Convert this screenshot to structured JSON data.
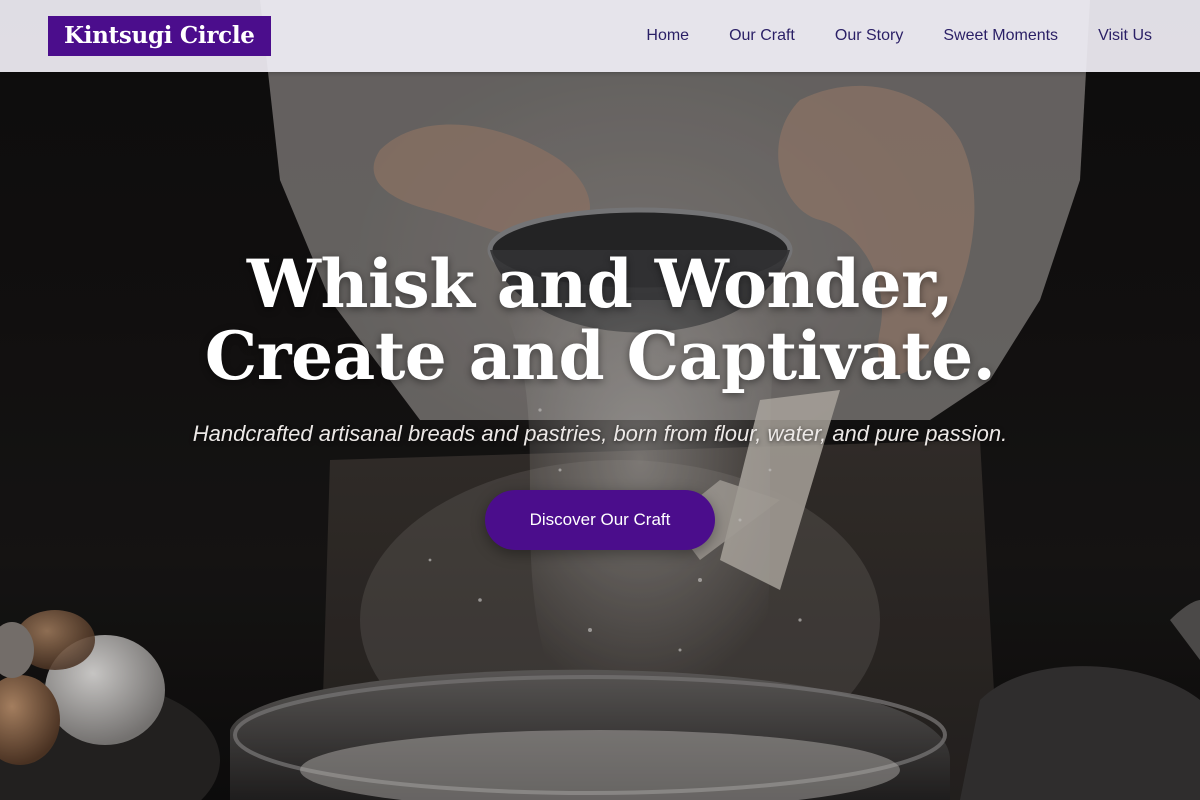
{
  "brand": {
    "name": "Kintsugi Circle",
    "color": "#4b0d8c"
  },
  "nav": {
    "items": [
      {
        "label": "Home"
      },
      {
        "label": "Our Craft"
      },
      {
        "label": "Our Story"
      },
      {
        "label": "Sweet Moments"
      },
      {
        "label": "Visit Us"
      }
    ]
  },
  "hero": {
    "headline_line1": "Whisk and Wonder,",
    "headline_line2": "Create and Captivate.",
    "tagline": "Handcrafted artisanal breads and pastries, born from flour, water, and pure passion.",
    "cta_label": "Discover Our Craft",
    "background_image": "baker-sifting-flour-photo"
  },
  "colors": {
    "accent": "#4b0d8c",
    "nav_text": "#2a1f66",
    "header_bg": "#f0eef5"
  }
}
